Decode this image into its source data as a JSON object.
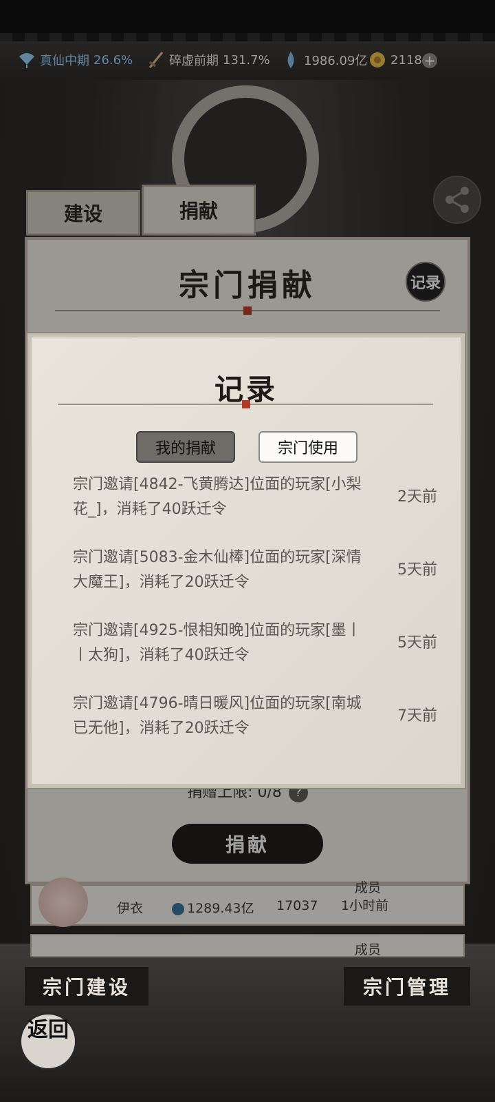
{
  "resources": [
    {
      "icon": "fan-icon",
      "label": "真仙中期",
      "value": "26.6%",
      "color": "#8fc3ea"
    },
    {
      "icon": "sword-icon",
      "label": "碎虚前期",
      "value": "131.7%",
      "color": "#ece7dd"
    },
    {
      "icon": "spirit-stone-icon",
      "label": "",
      "value": "1986.09亿",
      "color": "#ece7dd"
    },
    {
      "icon": "gold-coin-icon",
      "label": "",
      "value": "2118",
      "color": "#ece7dd"
    }
  ],
  "tabs": {
    "build": "建设",
    "donate": "捐献"
  },
  "panel": {
    "title": "宗门捐献",
    "record_badge": "记录"
  },
  "modal": {
    "title": "记录",
    "tab_mine": "我的捐献",
    "tab_sect": "宗门使用",
    "records": [
      {
        "text": "宗门邀请[4842-飞黄腾达]位面的玩家[小梨花_]，消耗了40跃迁令",
        "time": "2天前"
      },
      {
        "text": "宗门邀请[5083-金木仙棒]位面的玩家[深情大魔王]，消耗了20跃迁令",
        "time": "5天前"
      },
      {
        "text": "宗门邀请[4925-恨相知晚]位面的玩家[墨丨丨太狗]，消耗了40跃迁令",
        "time": "5天前"
      },
      {
        "text": "宗门邀请[4796-晴日暖风]位面的玩家[南城已无他]，消耗了20跃迁令",
        "time": "7天前"
      }
    ]
  },
  "donation": {
    "limit": "捐赠上限: 0/8",
    "donate_button": "捐献"
  },
  "members": [
    {
      "name": "伊衣",
      "power": "1289.43亿",
      "contribution": "17037",
      "role": "成员",
      "last_online": "1小时前"
    },
    {
      "role": "成员"
    }
  ],
  "bottom": {
    "build": "宗门建设",
    "manage": "宗门管理",
    "back": "返回"
  }
}
